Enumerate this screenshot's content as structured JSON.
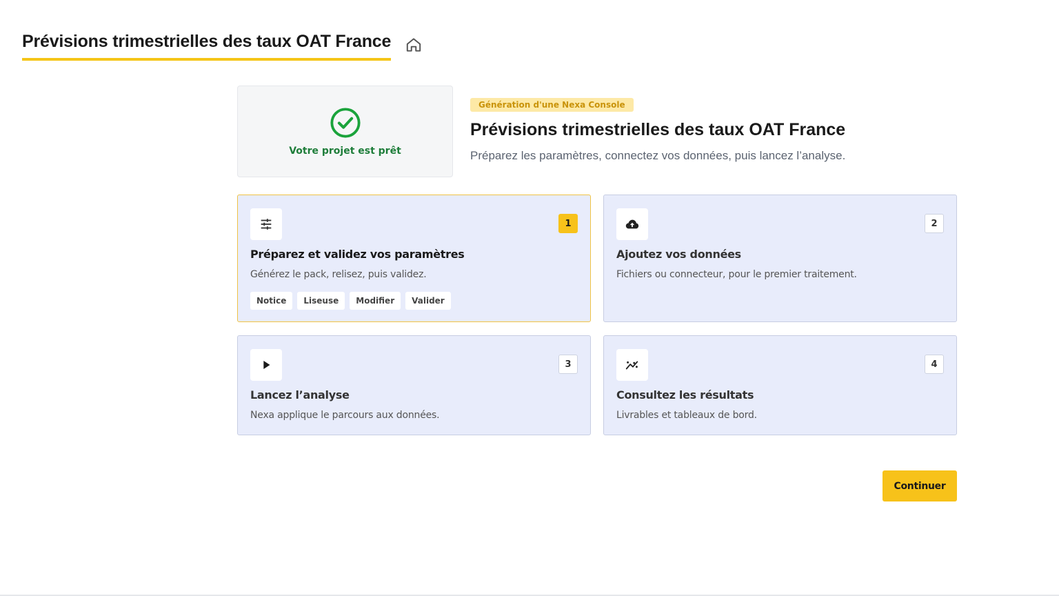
{
  "header": {
    "title": "Prévisions trimestrielles des taux OAT France",
    "home_icon": "home-icon"
  },
  "status": {
    "icon": "check-circle-icon",
    "text": "Votre projet est prêt",
    "color": "#1e7d3a"
  },
  "intro": {
    "badge": "Génération d'une Nexa Console",
    "title": "Prévisions trimestrielles des taux OAT France",
    "subtitle": "Préparez les paramètres, connectez vos données, puis lancez l’analyse."
  },
  "steps": [
    {
      "number": "1",
      "icon": "sliders-icon",
      "title": "Préparez et validez vos paramètres",
      "description": "Générez le pack, relisez, puis validez.",
      "chips": [
        "Notice",
        "Liseuse",
        "Modifier",
        "Valider"
      ]
    },
    {
      "number": "2",
      "icon": "cloud-upload-icon",
      "title": "Ajoutez vos données",
      "description": "Fichiers ou connecteur, pour le premier traitement."
    },
    {
      "number": "3",
      "icon": "play-icon",
      "title": "Lancez l’analyse",
      "description": "Nexa applique le parcours aux données."
    },
    {
      "number": "4",
      "icon": "trend-chart-icon",
      "title": "Consultez les résultats",
      "description": "Livrables et tableaux de bord."
    }
  ],
  "actions": {
    "continue_label": "Continuer"
  },
  "colors": {
    "accent": "#f7c21a",
    "card_bg": "#e8ecfb",
    "success": "#1e7d3a"
  }
}
